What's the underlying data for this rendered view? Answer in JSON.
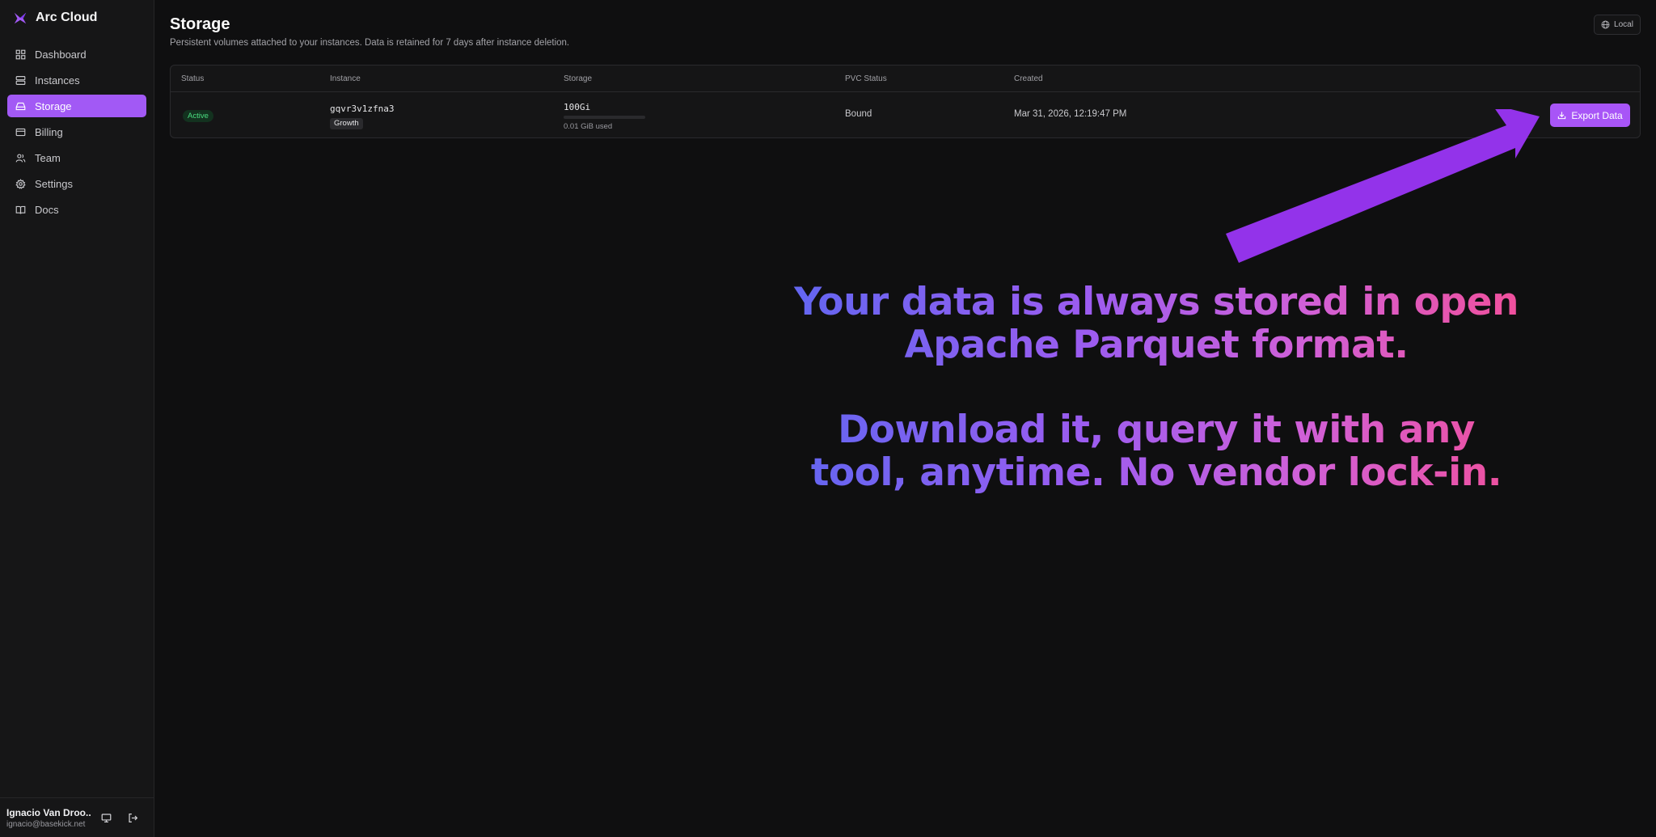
{
  "app": {
    "name": "Arc Cloud"
  },
  "sidebar": {
    "items": [
      {
        "label": "Dashboard",
        "icon": "dashboard-icon"
      },
      {
        "label": "Instances",
        "icon": "server-icon"
      },
      {
        "label": "Storage",
        "icon": "hard-drive-icon",
        "active": true
      },
      {
        "label": "Billing",
        "icon": "credit-card-icon"
      },
      {
        "label": "Team",
        "icon": "users-icon"
      },
      {
        "label": "Settings",
        "icon": "gear-icon"
      },
      {
        "label": "Docs",
        "icon": "book-icon"
      }
    ],
    "user": {
      "name": "Ignacio Van Droo...",
      "email": "ignacio@basekick.net"
    }
  },
  "page": {
    "title": "Storage",
    "subtitle": "Persistent volumes attached to your instances. Data is retained for 7 days after instance deletion.",
    "env_label": "Local"
  },
  "table": {
    "columns": [
      "Status",
      "Instance",
      "Storage",
      "PVC Status",
      "Created"
    ],
    "rows": [
      {
        "status": "Active",
        "instance_id": "gqvr3v1zfna3",
        "plan": "Growth",
        "storage_size": "100Gi",
        "usage_text": "0.01 GiB used",
        "usage_fraction": 0.0001,
        "pvc_status": "Bound",
        "created": "Mar 31, 2026, 12:19:47 PM",
        "action_label": "Export Data"
      }
    ]
  },
  "promo": {
    "line1": "Your data is always stored in open Apache Parquet format.",
    "line2": "Download it, query it with any tool, anytime. No vendor lock-in."
  },
  "colors": {
    "accent": "#a855f7",
    "active_green": "#4ade80",
    "background": "#0f0f10",
    "arrow": "#9333ea"
  }
}
